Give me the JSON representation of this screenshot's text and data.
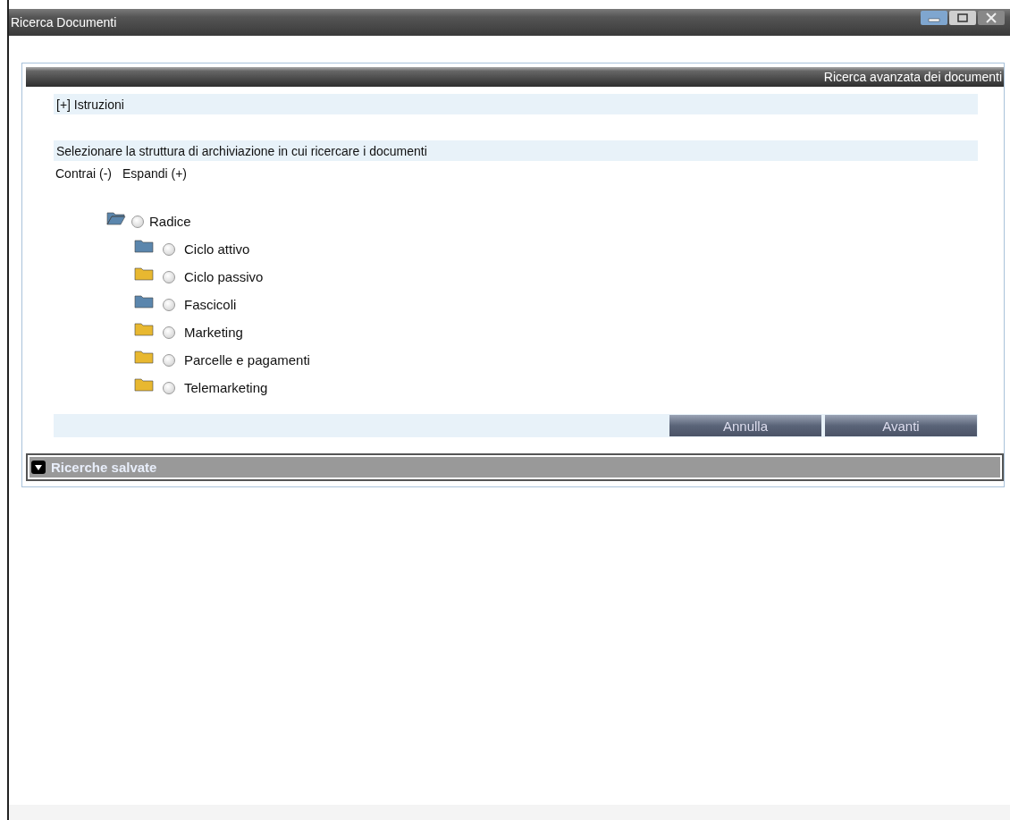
{
  "window": {
    "title": "Ricerca Documenti"
  },
  "panel": {
    "header": "Ricerca avanzata dei documenti",
    "instructions": "[+] Istruzioni",
    "prompt": "Selezionare la struttura di archiviazione in cui ricercare i documenti",
    "tree_actions": [
      "Contrai (-)",
      "Espandi (+)"
    ],
    "tree": [
      {
        "label": "Radice",
        "expanded": true,
        "selected": false,
        "color": "#5b86ad",
        "children": [
          {
            "label": "Ciclo attivo",
            "selected": false,
            "color": "#5b86ad"
          },
          {
            "label": "Ciclo passivo",
            "selected": false,
            "color": "#e8b830"
          },
          {
            "label": "Fascicoli",
            "selected": false,
            "color": "#5b86ad"
          },
          {
            "label": "Marketing",
            "selected": false,
            "color": "#e8b830"
          },
          {
            "label": "Parcelle e pagamenti",
            "selected": false,
            "color": "#e8b830"
          },
          {
            "label": "Telemarketing",
            "selected": false,
            "color": "#e8b830"
          }
        ]
      }
    ],
    "buttons": [
      "Annulla",
      "Avanti"
    ]
  },
  "saved_searches": {
    "label": "Ricerche salvate",
    "expanded": true
  }
}
